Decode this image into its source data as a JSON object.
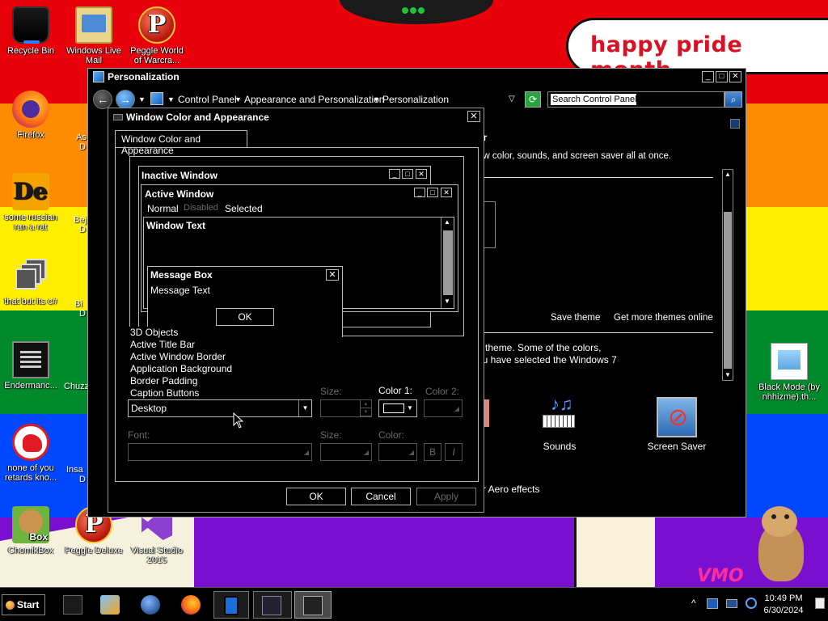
{
  "desktop": {
    "banner_text": "happy pride month",
    "icons": [
      {
        "label": "Recycle Bin",
        "icon": "recycle-bin-icon"
      },
      {
        "label": "Windows Live Mail",
        "icon": "mail-icon"
      },
      {
        "label": "Peggle World of Warcra...",
        "icon": "peggle-icon"
      },
      {
        "label": "Firefox",
        "icon": "firefox-icon"
      },
      {
        "label": "some russian ran a rat",
        "icon": "de-app-icon"
      },
      {
        "label": "that but its c#",
        "icon": "windows-stack-icon"
      },
      {
        "label": "Endermanc...",
        "icon": "console-icon"
      },
      {
        "label": "none of you retards kno...",
        "icon": "dino-icon"
      },
      {
        "label": "ChomikBox",
        "icon": "chomikbox-icon"
      },
      {
        "label": "Peggle Deluxe",
        "icon": "peggle-icon"
      },
      {
        "label": "Visual Studio 2015",
        "icon": "visual-studio-icon"
      },
      {
        "label": "Black Mode (by nhhizme).th...",
        "icon": "theme-file-icon"
      }
    ],
    "partial_labels": [
      "As",
      "D",
      "Bej",
      "D",
      "Bi",
      "D",
      "Chuzz",
      "Insa",
      "D"
    ],
    "chomik_badge": "Box",
    "watermark": "VMO"
  },
  "personalization": {
    "title": "Personalization",
    "breadcrumb": [
      "Control Panel",
      "Appearance and Personalization",
      "Personalization"
    ],
    "search_placeholder": "Search Control Panel",
    "heading_fragment": "er",
    "subtitle_fragment": "ow color, sounds, and screen saver all at once.",
    "save_theme": "Save theme",
    "get_more_themes": "Get more themes online",
    "body_line1": "7 theme.  Some of the colors,",
    "body_line2": "ou have selected the Windows 7",
    "sounds_label": "Sounds",
    "screen_saver_label": "Screen Saver",
    "aero_fragment": "r Aero effects"
  },
  "dialog": {
    "title": "Window Color and Appearance",
    "tab_label": "Window Color and Appearance",
    "preview": {
      "inactive_title": "Inactive Window",
      "active_title": "Active Window",
      "menu_normal": "Normal",
      "menu_disabled": "Disabled",
      "menu_selected": "Selected",
      "window_text": "Window Text",
      "msgbox_title": "Message Box",
      "msgbox_text": "Message Text",
      "msgbox_ok": "OK"
    },
    "item_list": [
      "3D Objects",
      "Active Title Bar",
      "Active Window Border",
      "Application Background",
      "Border Padding",
      "Caption Buttons"
    ],
    "item_selected": "Desktop",
    "size_label": "Size:",
    "color1_label": "Color 1:",
    "color2_label": "Color 2:",
    "font_label": "Font:",
    "font_size_label": "Size:",
    "font_color_label": "Color:",
    "bold_label": "B",
    "italic_label": "I",
    "ok_label": "OK",
    "cancel_label": "Cancel",
    "apply_label": "Apply"
  },
  "taskbar": {
    "start_label": "Start",
    "time": "10:49 PM",
    "date": "6/30/2024",
    "tray_overflow": "^"
  },
  "colors": {
    "flag": [
      "#e8000b",
      "#ff8c00",
      "#ffee00",
      "#018a2c",
      "#0048ff",
      "#7a0fd0"
    ],
    "banner_text": "#d81123",
    "window_bg": "#000000",
    "border": "#bbbbbb"
  }
}
